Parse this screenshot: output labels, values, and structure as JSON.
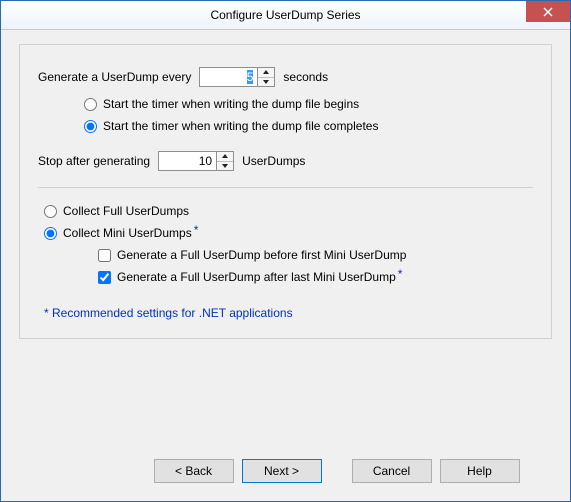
{
  "window": {
    "title": "Configure UserDump Series"
  },
  "section1": {
    "generate_label_pre": "Generate a UserDump every",
    "interval_value": "5",
    "generate_label_post": "seconds",
    "timer_begins": "Start the timer when writing the dump file begins",
    "timer_completes": "Start the timer when writing the dump file completes",
    "stop_label_pre": "Stop after generating",
    "stop_value": "10",
    "stop_label_post": "UserDumps"
  },
  "section2": {
    "full_dumps": "Collect Full UserDumps",
    "mini_dumps": "Collect Mini UserDumps",
    "gen_before": "Generate a Full UserDump before first Mini UserDump",
    "gen_after": "Generate a Full UserDump after last Mini UserDump"
  },
  "footer": {
    "recommend": "*  Recommended settings for .NET applications"
  },
  "buttons": {
    "back": "< Back",
    "next": "Next >",
    "cancel": "Cancel",
    "help": "Help"
  }
}
